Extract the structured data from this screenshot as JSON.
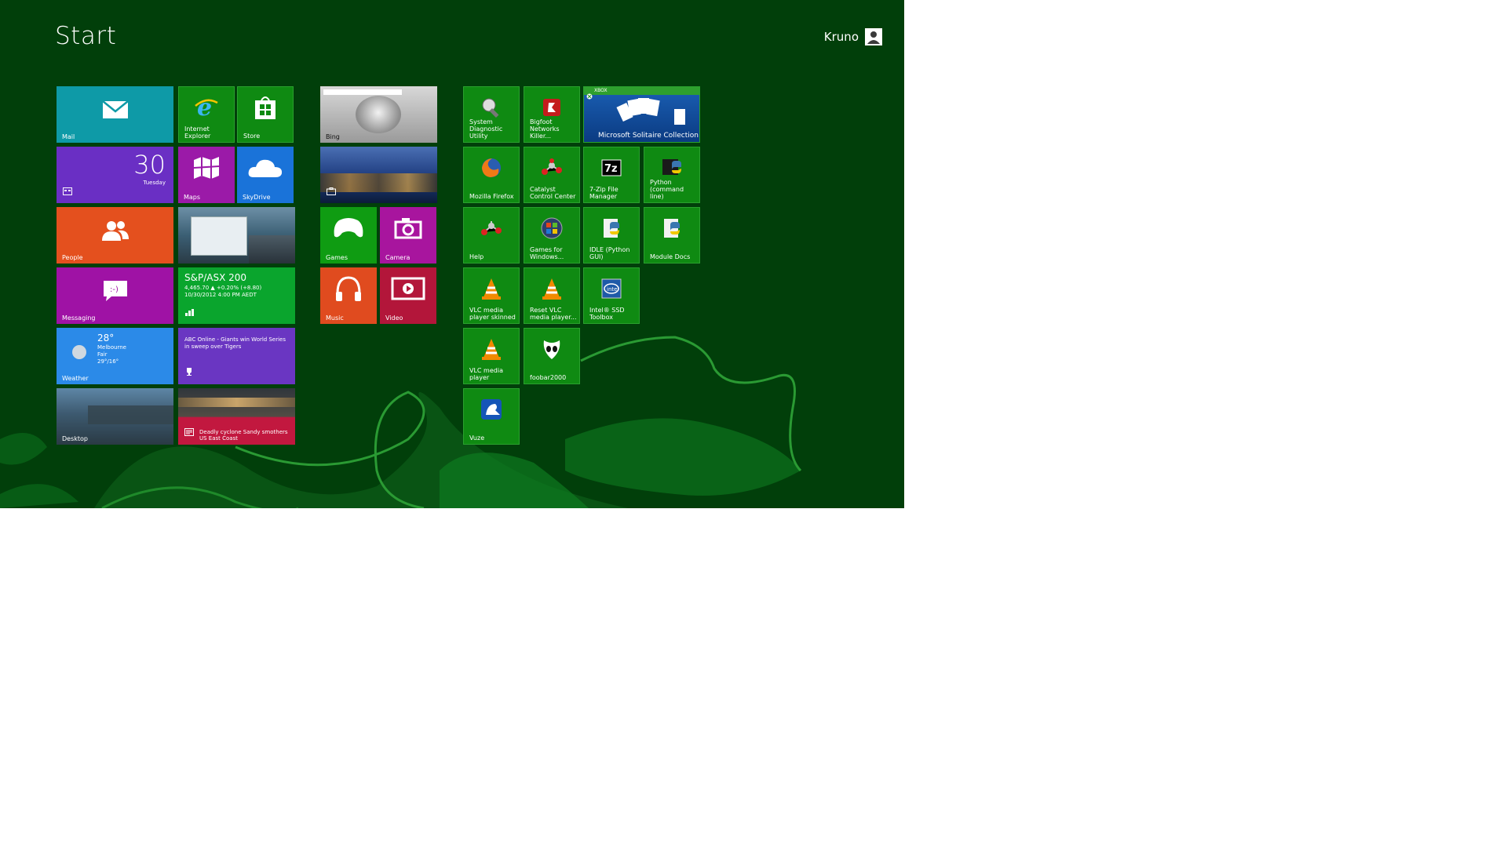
{
  "header": {
    "title": "Start",
    "user_name": "Kruno"
  },
  "tiles": {
    "mail": "Mail",
    "internet_explorer": "Internet Explorer",
    "store": "Store",
    "calendar_day": "30",
    "calendar_weekday": "Tuesday",
    "maps": "Maps",
    "skydrive": "SkyDrive",
    "people": "People",
    "messaging": "Messaging",
    "finance_title": "S&P/ASX 200",
    "finance_line1": "4,465.70 ▲ +0.20% (+8.80)",
    "finance_line2": "10/30/2012 4:00 PM AEDT",
    "weather_temp": "28°",
    "weather_city": "Melbourne",
    "weather_cond": "Fair",
    "weather_range": "29°/16°",
    "weather": "Weather",
    "sports_headline": "ABC Online - Giants win World Series in sweep over Tigers",
    "desktop": "Desktop",
    "news_headline": "Deadly cyclone Sandy smothers US East Coast",
    "bing": "Bing",
    "games": "Games",
    "camera": "Camera",
    "music": "Music",
    "video": "Video",
    "system_diag": "System Diagnostic Utility",
    "bigfoot": "Bigfoot Networks Killer...",
    "xbox": "XBOX",
    "solitaire": "Microsoft Solitaire Collection",
    "firefox": "Mozilla Firefox",
    "catalyst": "Catalyst Control Center",
    "sevenzip": "7-Zip File Manager",
    "python": "Python (command line)",
    "help": "Help",
    "games_windows": "Games for Windows...",
    "idle": "IDLE (Python GUI)",
    "module_docs": "Module Docs",
    "vlc_skinned": "VLC media player skinned",
    "reset_vlc": "Reset VLC media player...",
    "intel_ssd": "Intel® SSD Toolbox",
    "vlc": "VLC media player",
    "foobar": "foobar2000",
    "vuze": "Vuze"
  },
  "colors": {
    "background": "#013f0a",
    "tile_green": "#0f8a12",
    "mail": "#0e9aa7",
    "calendar": "#6a2fc4",
    "maps": "#9b1aa8",
    "skydrive": "#1a73d9",
    "people": "#e4501e",
    "messaging": "#9f12a5",
    "finance": "#0aa52d",
    "weather": "#2b8ae8",
    "sports": "#6a36c2",
    "news": "#c2183f",
    "games": "#0f9c12",
    "camera": "#a8159e",
    "music": "#e04b1f",
    "video": "#b3163a"
  }
}
